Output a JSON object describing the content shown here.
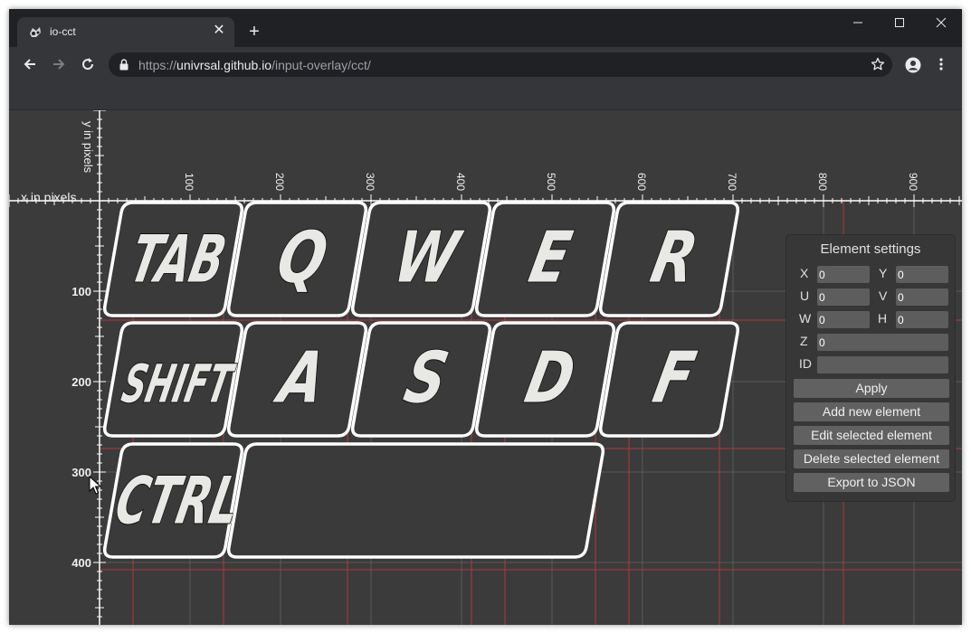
{
  "browser": {
    "tab_title": "io-cct",
    "new_tab": "+",
    "url_scheme": "https://",
    "url_host": "univrsal.github.io",
    "url_path": "/input-overlay/cct/"
  },
  "ruler": {
    "x_axis_label": "x in pixels",
    "y_axis_label": "y in pixels",
    "x_ticks": [
      "100",
      "200",
      "300",
      "400",
      "500",
      "600",
      "700",
      "800",
      "900"
    ],
    "y_ticks": [
      "100",
      "200",
      "300",
      "400"
    ]
  },
  "keys": [
    {
      "label": "TAB"
    },
    {
      "label": "Q"
    },
    {
      "label": "W"
    },
    {
      "label": "E"
    },
    {
      "label": "R"
    },
    {
      "label": "SHIFT"
    },
    {
      "label": "A"
    },
    {
      "label": "S"
    },
    {
      "label": "D"
    },
    {
      "label": "F"
    },
    {
      "label": "CTRL"
    },
    {
      "label": ""
    }
  ],
  "settings": {
    "title": "Element settings",
    "x_label": "X",
    "x_value": "0",
    "y_label": "Y",
    "y_value": "0",
    "u_label": "U",
    "u_value": "0",
    "v_label": "V",
    "v_value": "0",
    "w_label": "W",
    "w_value": "0",
    "h_label": "H",
    "h_value": "0",
    "z_label": "Z",
    "z_value": "0",
    "id_label": "ID",
    "id_value": "",
    "apply": "Apply",
    "add": "Add new element",
    "edit": "Edit selected element",
    "delete": "Delete selected element",
    "export": "Export to JSON"
  },
  "colors": {
    "canvas_bg": "#3b3b3b",
    "grid": "#5a5a5a",
    "red_guide": "#b03a3a",
    "key_fill": "#3a3a3a",
    "key_outline": "#ffffff",
    "key_text": "#e8e8e4"
  }
}
